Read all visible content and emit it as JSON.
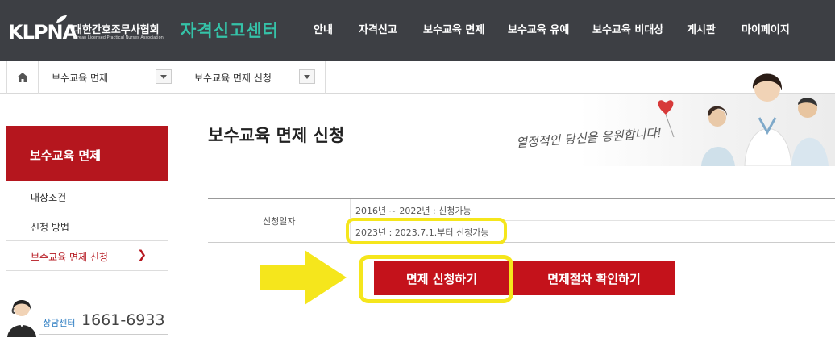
{
  "header": {
    "logo_text": "KLPNA",
    "logo_ko": "대한간호조무사협회",
    "logo_en": "Korean Licensed Practical Nurses Association",
    "site_title": "자격신고센터",
    "nav": [
      "안내",
      "자격신고",
      "보수교육 면제",
      "보수교육 유예",
      "보수교육 비대상",
      "게시판",
      "마이페이지"
    ]
  },
  "breadcrumb": {
    "level1": "보수교육 면제",
    "level2": "보수교육 면제 신청"
  },
  "sidebar": {
    "title": "보수교육 면제",
    "items": [
      {
        "label": "대상조건"
      },
      {
        "label": "신청 방법"
      },
      {
        "label": "보수교육 면제 신청",
        "active": true
      }
    ],
    "counsel_label": "상담센터",
    "counsel_phone": "1661-6933"
  },
  "main": {
    "title": "보수교육 면제 신청",
    "slogan": "열정적인 당신을 응원합니다!",
    "info": {
      "label": "신청일자",
      "row1": "2016년 ~ 2022년 : 신청가능",
      "row2": "2023년 : 2023.7.1.부터 신청가능"
    },
    "buttons": {
      "apply": "면제 신청하기",
      "check": "면제절차 확인하기"
    }
  },
  "colors": {
    "header_bg": "#3d3f44",
    "accent_red": "#c4121b",
    "title_teal": "#35c2a8",
    "highlight_yellow": "#f5e61c"
  }
}
